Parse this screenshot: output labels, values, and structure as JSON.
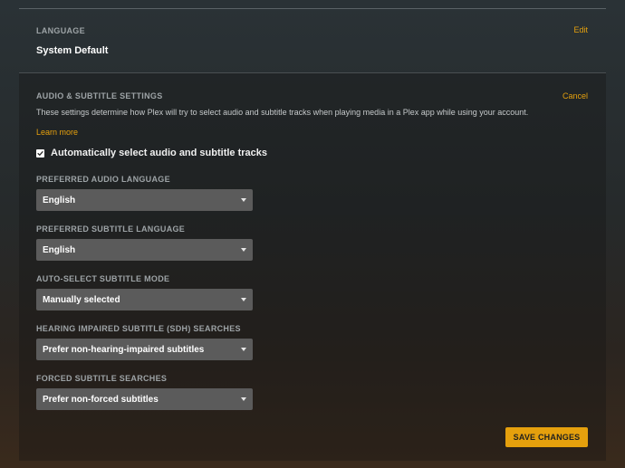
{
  "language": {
    "label": "LANGUAGE",
    "value": "System Default",
    "edit_label": "Edit"
  },
  "audio_subtitle": {
    "label": "AUDIO & SUBTITLE SETTINGS",
    "cancel_label": "Cancel",
    "description": "These settings determine how Plex will try to select audio and subtitle tracks when playing media in a Plex app while using your account.",
    "learn_more": "Learn more",
    "auto_select": {
      "label": "Automatically select audio and subtitle tracks",
      "checked": true
    },
    "fields": [
      {
        "label": "PREFERRED AUDIO LANGUAGE",
        "value": "English"
      },
      {
        "label": "PREFERRED SUBTITLE LANGUAGE",
        "value": "English"
      },
      {
        "label": "AUTO-SELECT SUBTITLE MODE",
        "value": "Manually selected"
      },
      {
        "label": "HEARING IMPAIRED SUBTITLE (SDH) SEARCHES",
        "value": "Prefer non-hearing-impaired subtitles"
      },
      {
        "label": "FORCED SUBTITLE SEARCHES",
        "value": "Prefer non-forced subtitles"
      }
    ],
    "save_label": "SAVE CHANGES"
  },
  "colors": {
    "accent": "#e5a00d",
    "select_bg": "#5b5b5b"
  },
  "icons": {
    "dropdown": "caret-down-icon",
    "checkbox": "checkmark-icon"
  }
}
